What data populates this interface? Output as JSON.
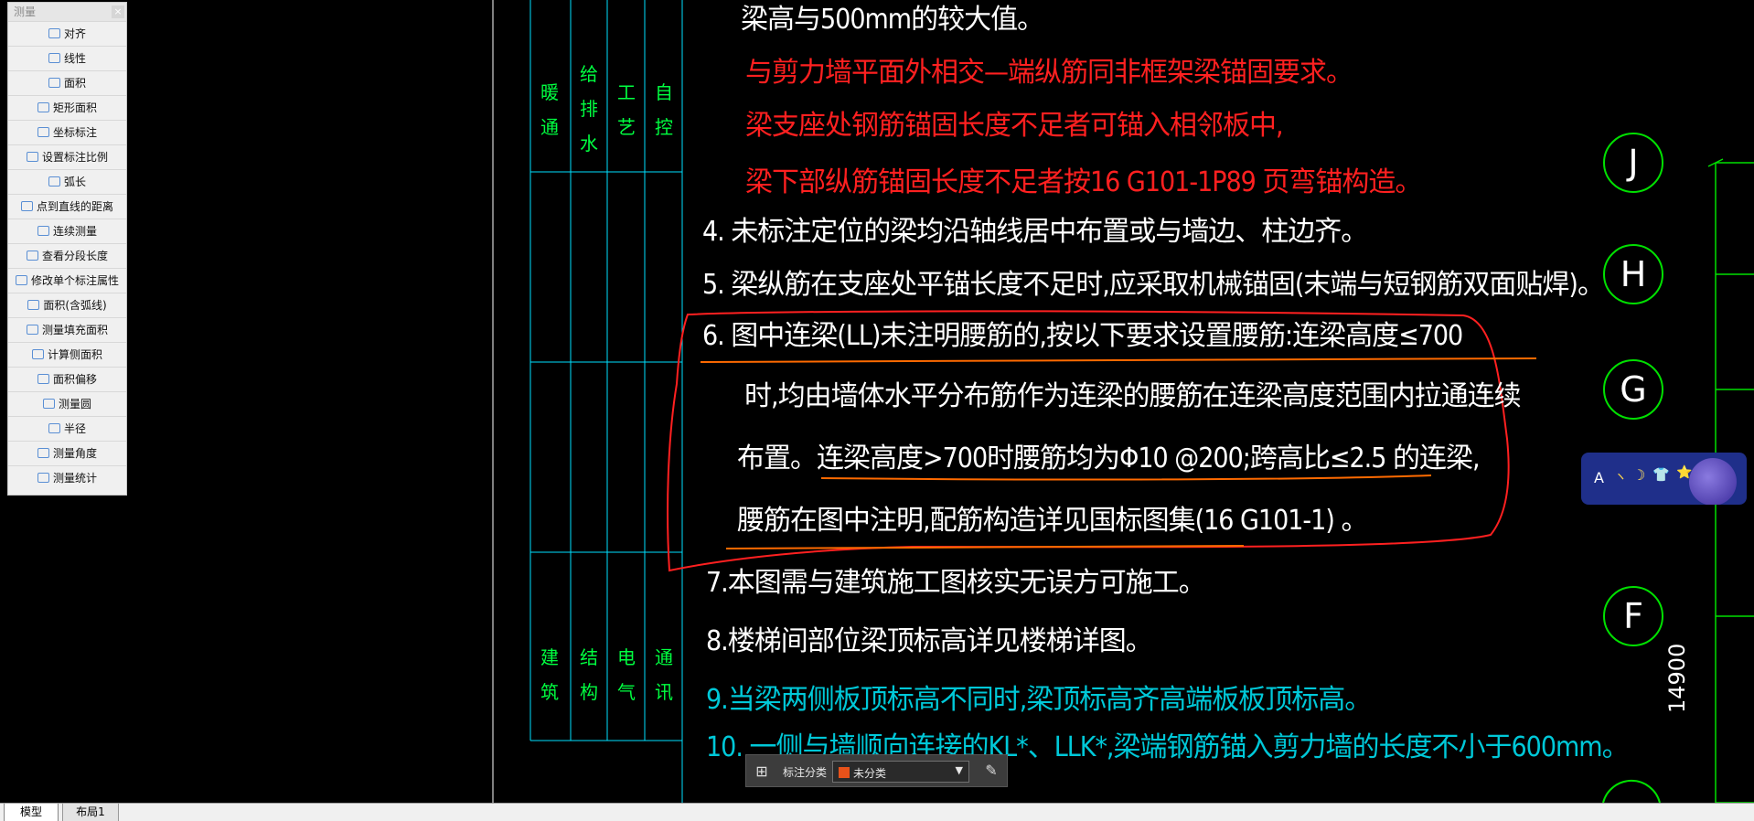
{
  "palette": {
    "title": "测量",
    "close": "×",
    "items": [
      {
        "label": "对齐",
        "icon": "align-dimension-icon"
      },
      {
        "label": "线性",
        "icon": "linear-dimension-icon"
      },
      {
        "label": "面积",
        "icon": "area-icon"
      },
      {
        "label": "矩形面积",
        "icon": "rect-area-icon"
      },
      {
        "label": "坐标标注",
        "icon": "coordinate-icon"
      },
      {
        "label": "设置标注比例",
        "icon": "scale-icon"
      },
      {
        "label": "弧长",
        "icon": "arc-length-icon"
      },
      {
        "label": "点到直线的距离",
        "icon": "point-line-distance-icon"
      },
      {
        "label": "连续测量",
        "icon": "continuous-measure-icon"
      },
      {
        "label": "查看分段长度",
        "icon": "segment-length-icon"
      },
      {
        "label": "修改单个标注属性",
        "icon": "edit-dimension-icon"
      },
      {
        "label": "面积(含弧线)",
        "icon": "arc-area-icon"
      },
      {
        "label": "测量填充面积",
        "icon": "hatch-area-icon"
      },
      {
        "label": "计算侧面积",
        "icon": "side-area-icon"
      },
      {
        "label": "面积偏移",
        "icon": "area-offset-icon"
      },
      {
        "label": "测量圆",
        "icon": "circle-measure-icon"
      },
      {
        "label": "半径",
        "icon": "radius-icon"
      },
      {
        "label": "测量角度",
        "icon": "angle-icon"
      },
      {
        "label": "测量统计",
        "icon": "statistics-icon"
      }
    ]
  },
  "signatures": {
    "col1": [
      "暖",
      "通"
    ],
    "col2": [
      "给",
      "排",
      "水"
    ],
    "col3": [
      "工",
      "艺"
    ],
    "col4": [
      "自",
      "控"
    ],
    "col1b": [
      "建",
      "筑"
    ],
    "col2b": [
      "结",
      "构"
    ],
    "col3b": [
      "电",
      "气"
    ],
    "col4b": [
      "通",
      "讯"
    ]
  },
  "notes": {
    "l0": "梁高与500mm的较大值。",
    "l1": "与剪力墙平面外相交—端纵筋同非框架梁锚固要求。",
    "l2": "梁支座处钢筋锚固长度不足者可锚入相邻板中,",
    "l3": "梁下部纵筋锚固长度不足者按16 G101-1P89 页弯锚构造。",
    "l4": "4. 未标注定位的梁均沿轴线居中布置或与墙边、柱边齐。",
    "l5": "5. 梁纵筋在支座处平锚长度不足时,应采取机械锚固(末端与短钢筋双面贴焊)。",
    "l6": "6. 图中连梁(LL)未注明腰筋的,按以下要求设置腰筋:连梁高度≤700",
    "l7": "时,均由墙体水平分布筋作为连梁的腰筋在连梁高度范围内拉通连续",
    "l8": "布置。连梁高度>700时腰筋均为Φ10 @200;跨高比≤2.5 的连梁,",
    "l9": "腰筋在图中注明,配筋构造详见国标图集(16 G101-1) 。",
    "l10": "7.本图需与建筑施工图核实无误方可施工。",
    "l11": "8.楼梯间部位梁顶标高详见楼梯详图。",
    "l12": "9.当梁两侧板顶标高不同时,梁顶标高齐高端板板顶标高。",
    "l13": "10. 一侧与墙顺向连接的KL*、LLK*,梁端钢筋锚入剪力墙的长度不小于600mm。"
  },
  "grid": {
    "axes": [
      "J",
      "H",
      "G",
      "F"
    ],
    "dimension": "14900"
  },
  "annotation_bar": {
    "label": "标注分类",
    "selected": "未分类",
    "swatch": "#e8521a"
  },
  "widget": {
    "a": "A",
    "b": "ヽ",
    "c": "☽",
    "d": "👕",
    "e": "⭐"
  },
  "tabs": {
    "model": "模型",
    "layout": "布局1"
  },
  "colors": {
    "background": "#000000",
    "frame_line": "#00e0ff",
    "markup_red": "#ff2020",
    "markup_orange": "#ff6a00"
  }
}
